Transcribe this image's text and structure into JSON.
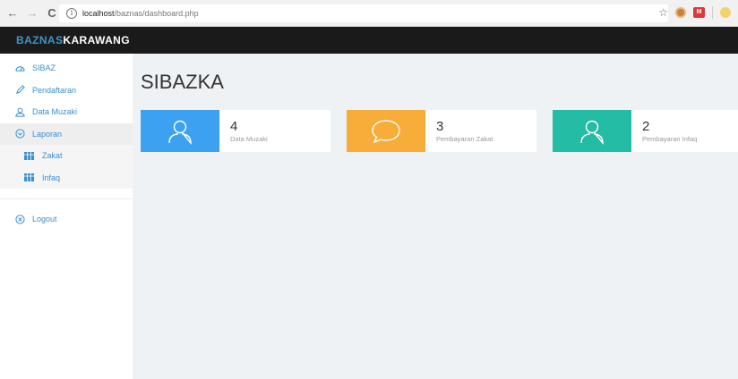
{
  "browser": {
    "url_host": "localhost",
    "url_path": "/baznas/dashboard.php"
  },
  "brand": {
    "part1": "BAZNAS",
    "part2": "KARAWANG"
  },
  "sidebar": {
    "items": [
      {
        "label": "SIBAZ",
        "icon": "dashboard-icon"
      },
      {
        "label": "Pendaftaran",
        "icon": "pencil-icon"
      },
      {
        "label": "Data Muzaki",
        "icon": "user-icon"
      },
      {
        "label": "Laporan",
        "icon": "chevron-circle-icon"
      },
      {
        "label": "Zakat",
        "icon": "grid-icon"
      },
      {
        "label": "Infaq",
        "icon": "grid-icon"
      },
      {
        "label": "Logout",
        "icon": "close-circle-icon"
      }
    ]
  },
  "main": {
    "title": "SIBAZKA",
    "cards": [
      {
        "value": "4",
        "label": "Data Muzaki",
        "color": "#3da1f2",
        "icon": "user-icon"
      },
      {
        "value": "3",
        "label": "Pembayaran Zakat",
        "color": "#f8ac3a",
        "icon": "chat-bubble-icon"
      },
      {
        "value": "2",
        "label": "Pembayaran Infaq",
        "color": "#24bca5",
        "icon": "user-icon"
      }
    ]
  }
}
